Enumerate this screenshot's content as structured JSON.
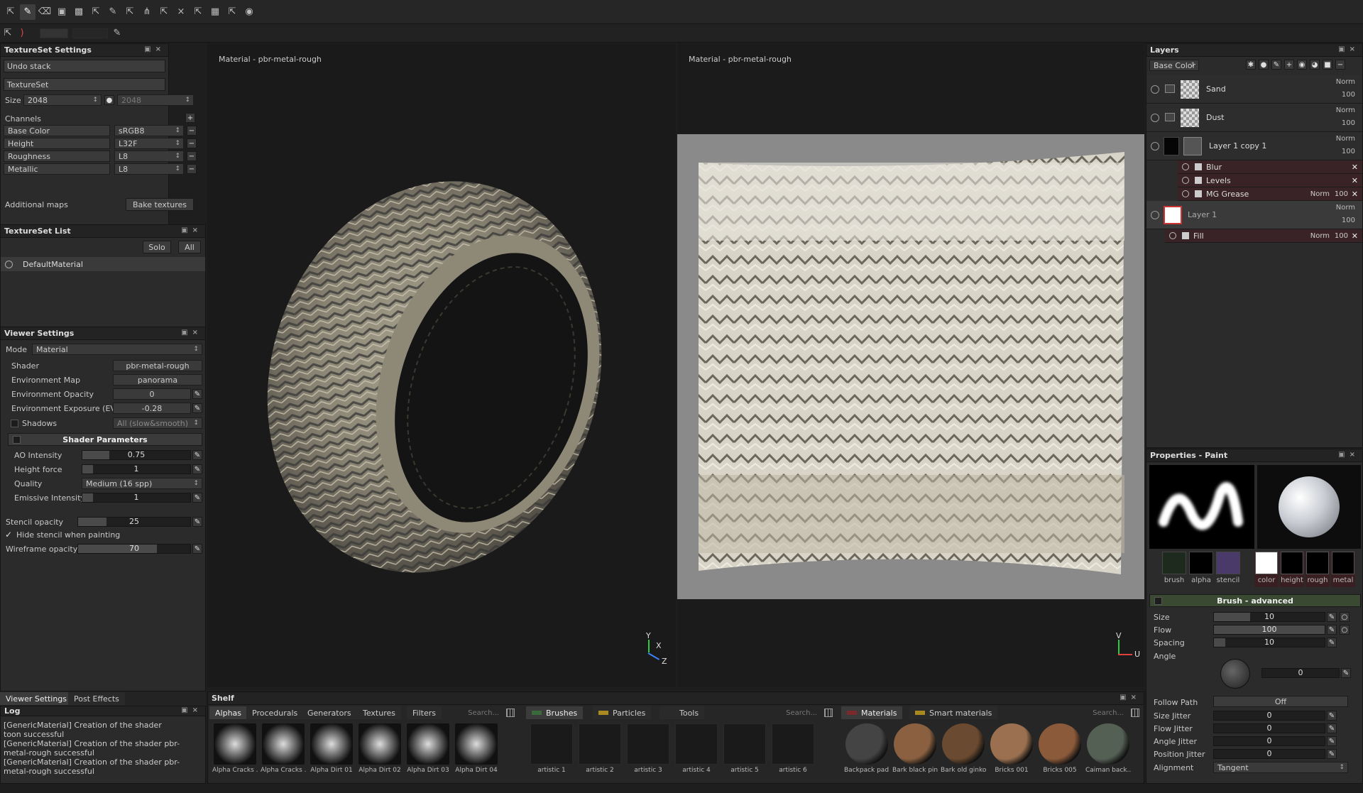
{
  "texture_set_settings": {
    "title": "TextureSet Settings",
    "undo_stack": "Undo stack",
    "texture_set": "TextureSet",
    "size_label": "Size",
    "size_value": "2048",
    "size_value2": "2048",
    "channels_label": "Channels",
    "channels": [
      {
        "name": "Base Color",
        "format": "sRGB8"
      },
      {
        "name": "Height",
        "format": "L32F"
      },
      {
        "name": "Roughness",
        "format": "L8"
      },
      {
        "name": "Metallic",
        "format": "L8"
      }
    ],
    "additional_maps": "Additional maps",
    "bake_textures": "Bake textures"
  },
  "texture_set_list": {
    "title": "TextureSet List",
    "solo": "Solo",
    "all": "All",
    "item": "DefaultMaterial"
  },
  "viewer_settings": {
    "title": "Viewer Settings",
    "mode_label": "Mode",
    "mode_value": "Material",
    "shader_label": "Shader",
    "shader_value": "pbr-metal-rough",
    "env_map_label": "Environment Map",
    "env_map_value": "panorama",
    "env_opacity_label": "Environment Opacity",
    "env_opacity_value": "0",
    "env_exposure_label": "Environment Exposure (EV)",
    "env_exposure_value": "-0.28",
    "shadows_label": "Shadows",
    "shadows_value": "All (slow&smooth)",
    "shader_params": "Shader Parameters",
    "ao_label": "AO Intensity",
    "ao_value": "0.75",
    "height_force_label": "Height force",
    "height_force_value": "1",
    "quality_label": "Quality",
    "quality_value": "Medium (16 spp)",
    "emissive_label": "Emissive Intensity",
    "emissive_value": "1",
    "stencil_label": "Stencil opacity",
    "stencil_value": "25",
    "hide_stencil": "Hide stencil when painting",
    "wireframe_label": "Wireframe opacity",
    "wireframe_value": "70"
  },
  "bottom_tabs": {
    "viewer": "Viewer Settings",
    "post": "Post Effects"
  },
  "log": {
    "title": "Log",
    "lines": [
      "[GenericMaterial] Creation of the shader toon successful",
      "[GenericMaterial] Creation of the shader pbr-metal-rough successful",
      "[GenericMaterial] Creation of the shader pbr-metal-rough successful"
    ]
  },
  "viewport3d": {
    "title": "Material - pbr-metal-rough",
    "axis_y": "Y",
    "axis_x": "X",
    "axis_z": "Z"
  },
  "viewport2d": {
    "title": "Material - pbr-metal-rough",
    "axis_v": "V",
    "axis_u": "U"
  },
  "layers": {
    "title": "Layers",
    "channel": "Base Color",
    "rows": [
      {
        "name": "Sand",
        "blend": "Norm",
        "opacity": "100"
      },
      {
        "name": "Dust",
        "blend": "Norm",
        "opacity": "100"
      },
      {
        "name": "Layer 1 copy 1",
        "blend": "Norm",
        "opacity": "100"
      },
      {
        "name": "Layer 1",
        "blend": "Norm",
        "opacity": "100"
      }
    ],
    "effects": [
      {
        "name": "Blur",
        "blend": "",
        "opacity": ""
      },
      {
        "name": "Levels",
        "blend": "",
        "opacity": ""
      },
      {
        "name": "MG Grease",
        "blend": "Norm",
        "opacity": "100"
      },
      {
        "name": "Fill",
        "blend": "Norm",
        "opacity": "100"
      }
    ]
  },
  "properties": {
    "title": "Properties - Paint",
    "slots": [
      "brush",
      "alpha",
      "stencil"
    ],
    "material_slots": [
      "color",
      "height",
      "rough",
      "metal"
    ],
    "brush_section": "Brush - advanced",
    "size_label": "Size",
    "size_value": "10",
    "size_fill": 0.33,
    "flow_label": "Flow",
    "flow_value": "100",
    "flow_fill": 1.0,
    "spacing_label": "Spacing",
    "spacing_value": "10",
    "spacing_fill": 0.1,
    "angle_label": "Angle",
    "angle_value": "0",
    "follow_path_label": "Follow Path",
    "follow_path_value": "Off",
    "size_jitter_label": "Size Jitter",
    "size_jitter_value": "0",
    "flow_jitter_label": "Flow Jitter",
    "flow_jitter_value": "0",
    "angle_jitter_label": "Angle Jitter",
    "angle_jitter_value": "0",
    "position_jitter_label": "Position Jitter",
    "position_jitter_value": "0",
    "alignment_label": "Alignment",
    "alignment_value": "Tangent"
  },
  "shelf": {
    "title": "Shelf",
    "left_tabs": [
      "Alphas",
      "Procedurals",
      "Generators",
      "Textures",
      "Filters"
    ],
    "search": "Search...",
    "alphas": [
      "Alpha Cracks ...",
      "Alpha Cracks ...",
      "Alpha Dirt 01",
      "Alpha Dirt 02",
      "Alpha Dirt 03",
      "Alpha Dirt 04"
    ],
    "mid_tabs": [
      "Brushes",
      "Particles",
      "Tools"
    ],
    "brushes": [
      "artistic 1",
      "artistic 2",
      "artistic 3",
      "artistic 4",
      "artistic 5",
      "artistic 6"
    ],
    "right_tabs": [
      "Materials",
      "Smart materials"
    ],
    "materials": [
      "Backpack pad...",
      "Bark black pine",
      "Bark old ginko",
      "Bricks 001",
      "Bricks 005",
      "Caiman back..."
    ]
  }
}
